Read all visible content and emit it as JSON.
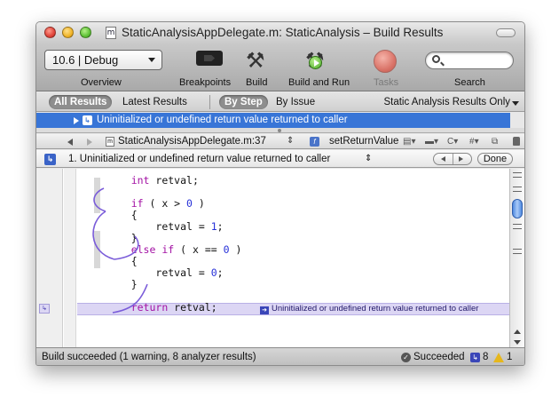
{
  "window": {
    "title": "StaticAnalysisAppDelegate.m: StaticAnalysis – Build Results",
    "doc_icon_glyph": "m"
  },
  "toolbar": {
    "config_value": "10.6 | Debug",
    "overview_label": "Overview",
    "breakpoints_label": "Breakpoints",
    "build_label": "Build",
    "build_run_label": "Build and Run",
    "tasks_label": "Tasks",
    "search_label": "Search",
    "search_value": "",
    "tasks_color": "#e0695c"
  },
  "scope_bar": {
    "all_results": "All Results",
    "latest_results": "Latest Results",
    "by_step": "By Step",
    "by_issue": "By Issue",
    "filter_value": "Static Analysis Results Only"
  },
  "results": {
    "selected_row": "Uninitialized or undefined return value returned to caller",
    "selection_color": "#3875d7"
  },
  "nav_bar": {
    "file": "StaticAnalysisAppDelegate.m:37",
    "function": "setReturnValue",
    "updown_glyph": "⇕",
    "mini_c": "C",
    "mini_hash": "#"
  },
  "message_bar": {
    "message": "1. Uninitialized or undefined return value returned to caller",
    "updown_glyph": "⇕",
    "done_label": "Done"
  },
  "code": {
    "lines": [
      {
        "indent": "    ",
        "parts": [
          {
            "t": "int",
            "c": "kw"
          },
          {
            "t": " retval;",
            "c": ""
          }
        ]
      },
      {
        "indent": "",
        "parts": []
      },
      {
        "indent": "    ",
        "parts": [
          {
            "t": "if",
            "c": "kw"
          },
          {
            "t": " ( x > ",
            "c": ""
          },
          {
            "t": "0",
            "c": "num"
          },
          {
            "t": " )",
            "c": ""
          }
        ]
      },
      {
        "indent": "    ",
        "parts": [
          {
            "t": "{",
            "c": ""
          }
        ]
      },
      {
        "indent": "        ",
        "parts": [
          {
            "t": "retval = ",
            "c": ""
          },
          {
            "t": "1",
            "c": "num"
          },
          {
            "t": ";",
            "c": ""
          }
        ]
      },
      {
        "indent": "    ",
        "parts": [
          {
            "t": "}",
            "c": ""
          }
        ]
      },
      {
        "indent": "    ",
        "parts": [
          {
            "t": "else",
            "c": "kw"
          },
          {
            "t": " ",
            "c": ""
          },
          {
            "t": "if",
            "c": "kw"
          },
          {
            "t": " ( x == ",
            "c": ""
          },
          {
            "t": "0",
            "c": "num"
          },
          {
            "t": " )",
            "c": ""
          }
        ]
      },
      {
        "indent": "    ",
        "parts": [
          {
            "t": "{",
            "c": ""
          }
        ]
      },
      {
        "indent": "        ",
        "parts": [
          {
            "t": "retval = ",
            "c": ""
          },
          {
            "t": "0",
            "c": "num"
          },
          {
            "t": ";",
            "c": ""
          }
        ]
      },
      {
        "indent": "    ",
        "parts": [
          {
            "t": "}",
            "c": ""
          }
        ]
      },
      {
        "indent": "",
        "parts": []
      },
      {
        "indent": "    ",
        "parts": [
          {
            "t": "return",
            "c": "kw"
          },
          {
            "t": " retval;",
            "c": ""
          }
        ]
      }
    ],
    "inline_issue": "Uninitialized or undefined return value returned to caller",
    "highlight_color": "#dcd6f4",
    "keyword_color": "#a312a4",
    "number_color": "#2630d8",
    "path_arrow_color": "#7a5cd9"
  },
  "status_bar": {
    "text": "Build succeeded (1 warning, 8 analyzer results)",
    "succeeded": "Succeeded",
    "analyzer_count": "8",
    "warning_count": "1",
    "warning_color": "#e6b71c"
  }
}
